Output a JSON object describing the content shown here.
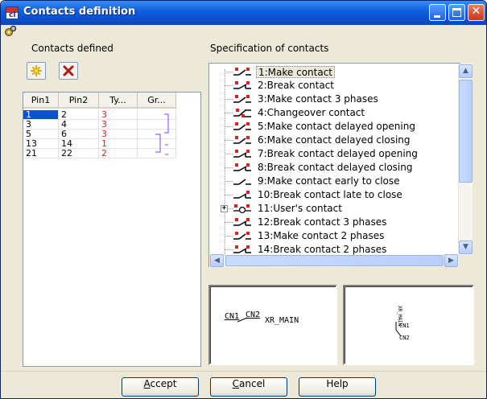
{
  "window": {
    "title": "Contacts definition"
  },
  "left": {
    "label": "Contacts defined",
    "columns": [
      "Pin1",
      "Pin2",
      "Ty...",
      "Gr..."
    ],
    "rows": [
      {
        "pin1": "1",
        "pin2": "2",
        "type": "3"
      },
      {
        "pin1": "3",
        "pin2": "4",
        "type": "3"
      },
      {
        "pin1": "5",
        "pin2": "6",
        "type": "3"
      },
      {
        "pin1": "13",
        "pin2": "14",
        "type": "1"
      },
      {
        "pin1": "21",
        "pin2": "22",
        "type": "2"
      }
    ]
  },
  "right": {
    "label": "Specification of contacts",
    "items": [
      "1:Make contact",
      "2:Break contact",
      "3:Make contact 3 phases",
      "4:Changeover contact",
      "5:Make contact delayed opening",
      "6:Make contact delayed closing",
      "7:Break contact delayed opening",
      "8:Break contact delayed closing",
      "9:Make contact early to close",
      "10:Break contact late to close",
      "11:User's contact",
      "12:Break contact 3 phases",
      "13:Make contact 2 phases",
      "14:Break contact 2 phases"
    ]
  },
  "preview1": {
    "pin1": "CN1",
    "pin2": "CN2",
    "name": "XR_MAIN"
  },
  "preview2": {
    "name": "XR_MAIN",
    "pin1": "CN1",
    "pin2": "CN2"
  },
  "buttons": {
    "accept_key": "A",
    "accept_rest": "ccept",
    "cancel_key": "C",
    "cancel_rest": "ancel",
    "help": "Help"
  },
  "colors": {
    "titlebar": "#0a4fd0",
    "selection": "#0a52cc",
    "type_text": "#e02020",
    "group_marker": "#8040ff"
  }
}
